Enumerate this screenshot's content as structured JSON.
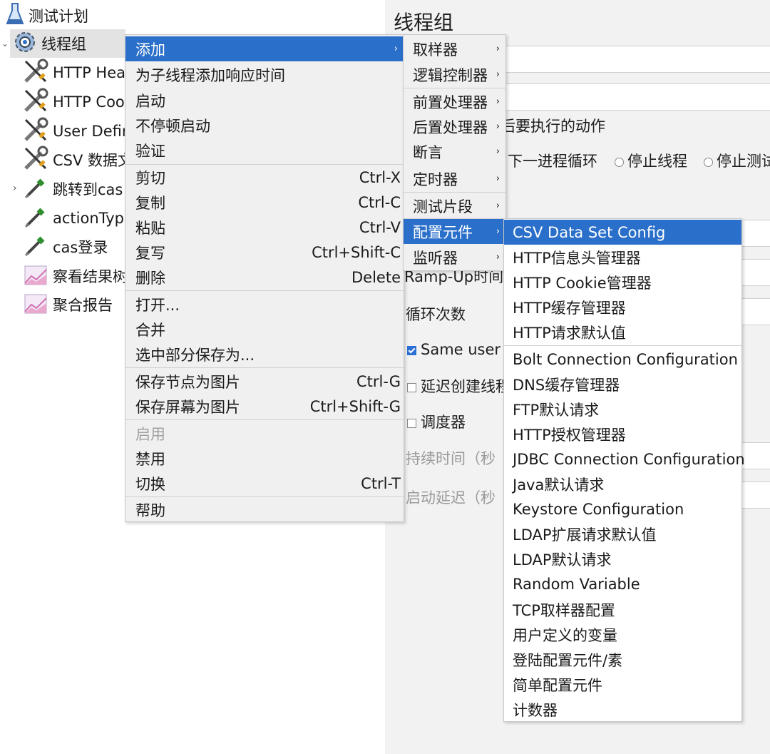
{
  "tree": {
    "items": [
      {
        "label": "测试计划"
      },
      {
        "label": "线程组"
      },
      {
        "label": "HTTP Heac"
      },
      {
        "label": "HTTP Cool"
      },
      {
        "label": "User Defin"
      },
      {
        "label": "CSV 数据文"
      },
      {
        "label": "跳转到cas"
      },
      {
        "label": "actionType"
      },
      {
        "label": "cas登录"
      },
      {
        "label": "察看结果树"
      },
      {
        "label": "聚合报告"
      }
    ]
  },
  "panel": {
    "title": "线程组",
    "action_label": "后要执行的动作",
    "radio_next_loop": "下一进程循环",
    "radio_stop_thread": "停止线程",
    "radio_stop_test": "停止测试",
    "rampup_label": "Ramp-Up时间",
    "loop_label": "循环次数",
    "same_user": "Same user o",
    "delay_create": "延迟创建线程",
    "scheduler": "调度器",
    "duration": "持续时间（秒",
    "startup_delay": "启动延迟（秒"
  },
  "context_menu": {
    "items": [
      {
        "label": "添加",
        "shortcut": ""
      },
      {
        "label": "为子线程添加响应时间",
        "shortcut": ""
      },
      {
        "label": "启动",
        "shortcut": ""
      },
      {
        "label": "不停顿启动",
        "shortcut": ""
      },
      {
        "label": "验证",
        "shortcut": ""
      },
      {
        "label": "剪切",
        "shortcut": "Ctrl-X"
      },
      {
        "label": "复制",
        "shortcut": "Ctrl-C"
      },
      {
        "label": "粘贴",
        "shortcut": "Ctrl-V"
      },
      {
        "label": "复写",
        "shortcut": "Ctrl+Shift-C"
      },
      {
        "label": "删除",
        "shortcut": "Delete"
      },
      {
        "label": "打开...",
        "shortcut": ""
      },
      {
        "label": "合并",
        "shortcut": ""
      },
      {
        "label": "选中部分保存为...",
        "shortcut": ""
      },
      {
        "label": "保存节点为图片",
        "shortcut": "Ctrl-G"
      },
      {
        "label": "保存屏幕为图片",
        "shortcut": "Ctrl+Shift-G"
      },
      {
        "label": "启用",
        "shortcut": ""
      },
      {
        "label": "禁用",
        "shortcut": ""
      },
      {
        "label": "切换",
        "shortcut": "Ctrl-T"
      },
      {
        "label": "帮助",
        "shortcut": ""
      }
    ]
  },
  "add_menu": {
    "items": [
      {
        "label": "取样器"
      },
      {
        "label": "逻辑控制器"
      },
      {
        "label": "前置处理器"
      },
      {
        "label": "后置处理器"
      },
      {
        "label": "断言"
      },
      {
        "label": "定时器"
      },
      {
        "label": "测试片段"
      },
      {
        "label": "配置元件"
      },
      {
        "label": "监听器"
      }
    ]
  },
  "config_menu": {
    "items": [
      {
        "label": "CSV Data Set Config"
      },
      {
        "label": "HTTP信息头管理器"
      },
      {
        "label": "HTTP Cookie管理器"
      },
      {
        "label": "HTTP缓存管理器"
      },
      {
        "label": "HTTP请求默认值"
      },
      {
        "label": "Bolt Connection Configuration"
      },
      {
        "label": "DNS缓存管理器"
      },
      {
        "label": "FTP默认请求"
      },
      {
        "label": "HTTP授权管理器"
      },
      {
        "label": "JDBC Connection Configuration"
      },
      {
        "label": "Java默认请求"
      },
      {
        "label": "Keystore Configuration"
      },
      {
        "label": "LDAP扩展请求默认值"
      },
      {
        "label": "LDAP默认请求"
      },
      {
        "label": "Random Variable"
      },
      {
        "label": "TCP取样器配置"
      },
      {
        "label": "用户定义的变量"
      },
      {
        "label": "登陆配置元件/素"
      },
      {
        "label": "简单配置元件"
      },
      {
        "label": "计数器"
      }
    ]
  },
  "colors": {
    "highlight": "#2a6fc9",
    "menu_bg": "#f0f0f0",
    "panel_bg": "#f2f2f2"
  }
}
